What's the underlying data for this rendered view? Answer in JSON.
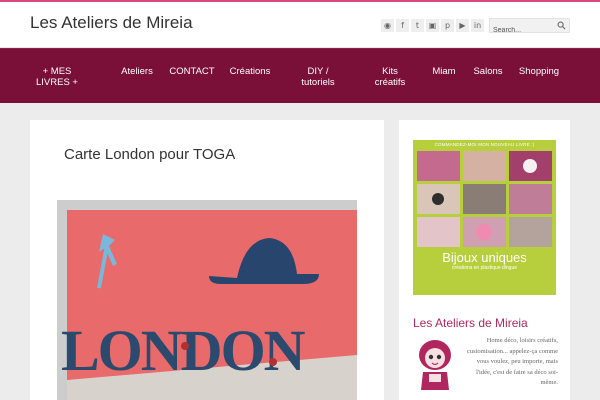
{
  "site": {
    "title": "Les Ateliers de Mireia"
  },
  "social": [
    {
      "icon": "rss-icon",
      "glyph": "◉"
    },
    {
      "icon": "facebook-icon",
      "glyph": "f"
    },
    {
      "icon": "twitter-icon",
      "glyph": "t"
    },
    {
      "icon": "instagram-icon",
      "glyph": "▣"
    },
    {
      "icon": "pinterest-icon",
      "glyph": "p"
    },
    {
      "icon": "youtube-icon",
      "glyph": "▶"
    },
    {
      "icon": "linkedin-icon",
      "glyph": "in"
    }
  ],
  "search": {
    "placeholder": "Search..."
  },
  "nav": {
    "items": [
      {
        "label": "+ MES LIVRES +"
      },
      {
        "label": "Ateliers"
      },
      {
        "label": "CONTACT"
      },
      {
        "label": "Créations"
      },
      {
        "label": "DIY / tutoriels"
      },
      {
        "label": "Kits créatifs"
      },
      {
        "label": "Miam"
      },
      {
        "label": "Salons"
      },
      {
        "label": "Shopping"
      }
    ]
  },
  "post": {
    "title": "Carte London pour TOGA"
  },
  "sidebar": {
    "book_banner": "COMMANDEZ-MOI MON NOUVEAU LIVRE :)",
    "book_title": "Bijoux uniques",
    "book_subtitle": "créations en plastique dingue",
    "widget_title": "Les Ateliers de Mireia",
    "about": "Home déco, loisirs créatifs, customisation... appelez-ça comme vous voulez, peu importe, mais l'idée, c'est de faire sa déco soi-même."
  },
  "colors": {
    "accent": "#7a1038",
    "highlight": "#b0275f",
    "book_bg": "#b7cf3c"
  }
}
